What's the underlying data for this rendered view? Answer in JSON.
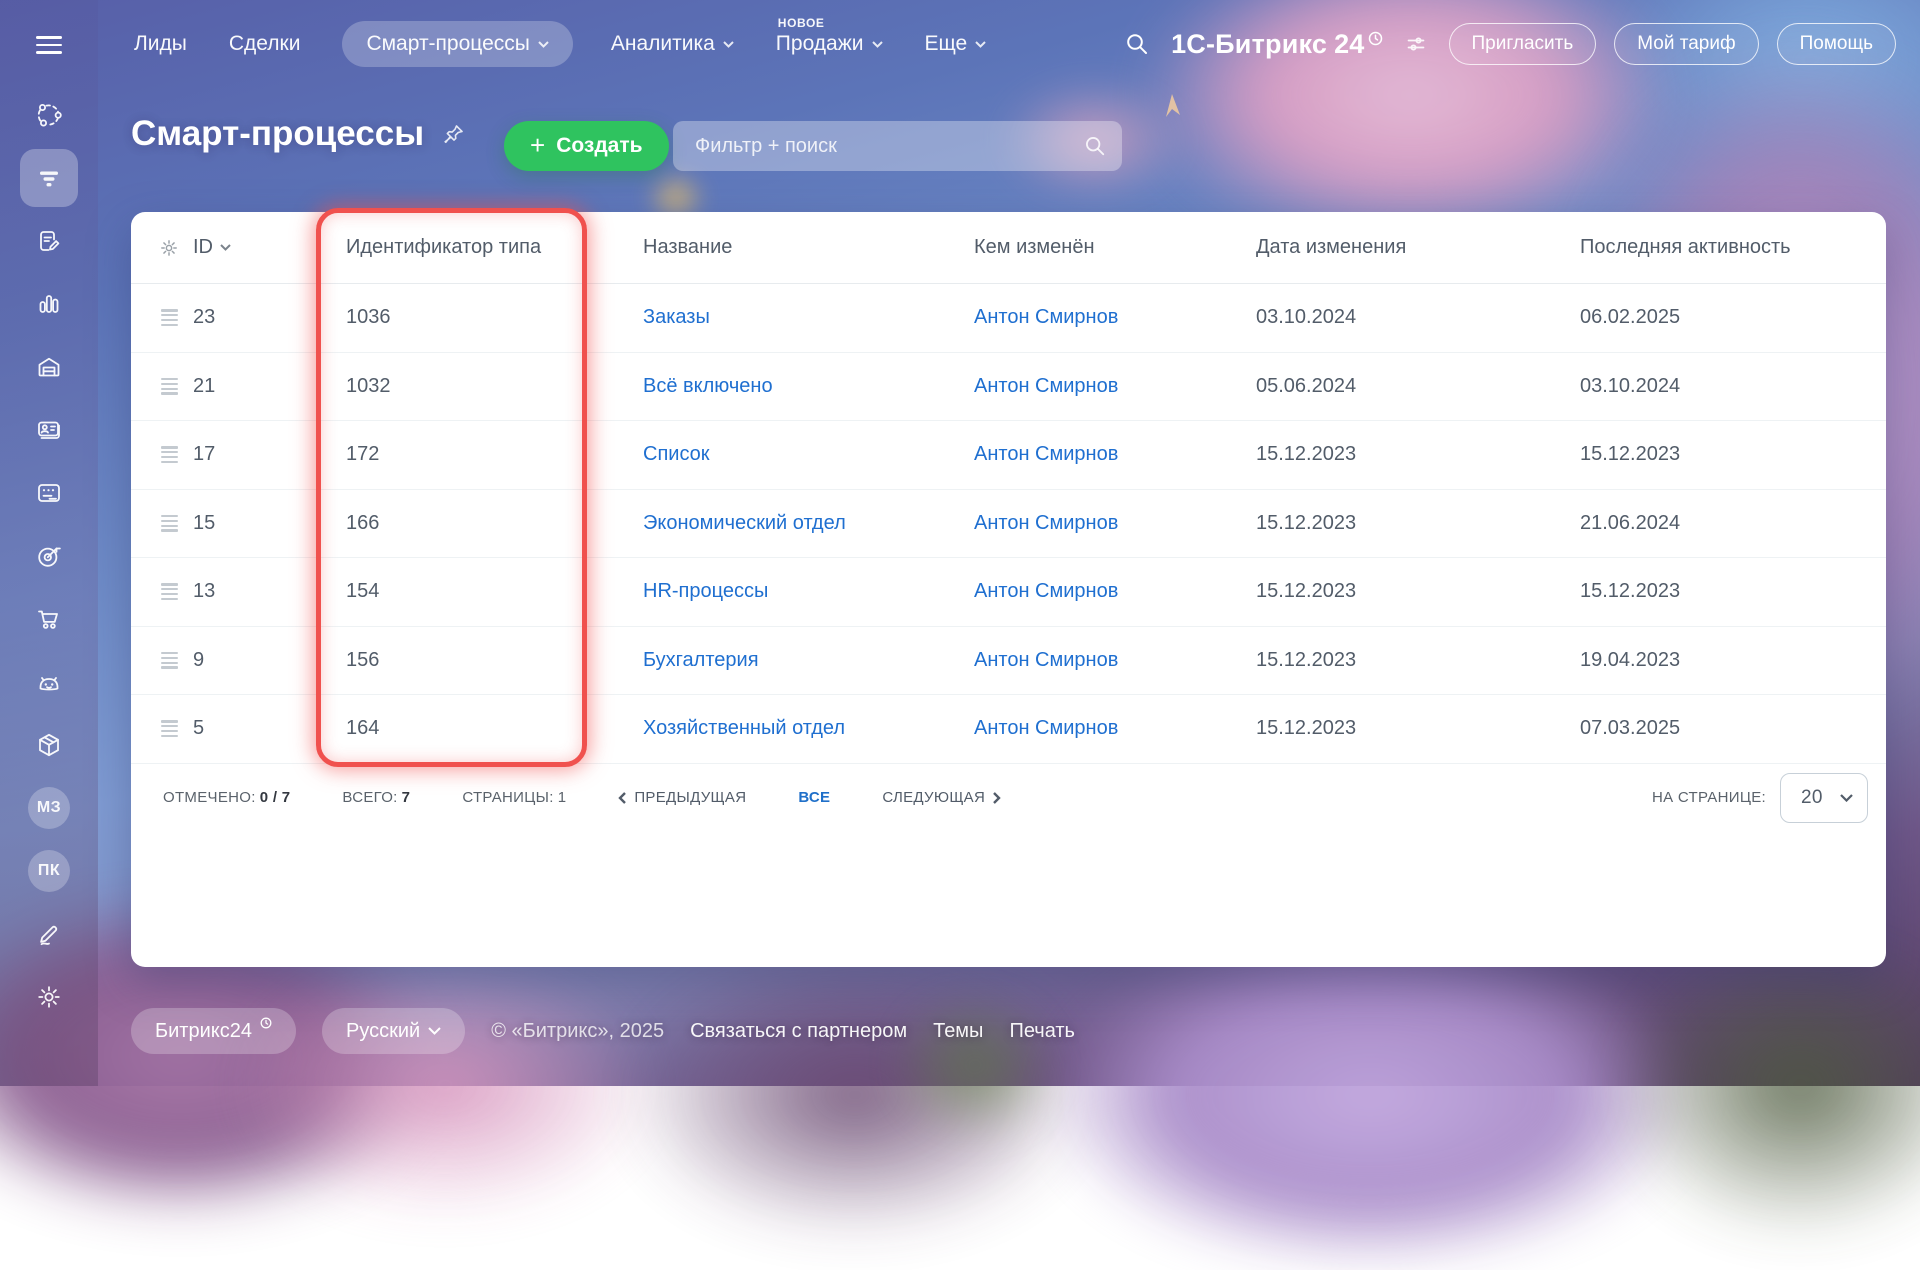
{
  "colors": {
    "accent_green": "#2fc35f",
    "link_blue": "#1f6fd0",
    "highlight_red": "#f0514e",
    "cell_text": "#525c69",
    "topbar_text": "#ffffff"
  },
  "topbar": {
    "nav": [
      {
        "label": "Лиды"
      },
      {
        "label": "Сделки"
      },
      {
        "label": "Смарт-процессы",
        "active": true
      },
      {
        "label": "Аналитика"
      },
      {
        "label": "Продажи",
        "badge": "НОВОЕ"
      },
      {
        "label": "Еще"
      }
    ],
    "logo_text": "1С-Битрикс",
    "logo_24": "24",
    "buttons": [
      "Пригласить",
      "Мой тариф",
      "Помощь"
    ]
  },
  "page": {
    "title": "Смарт-процессы",
    "create_label": "Создать",
    "create_plus": "+",
    "filter_placeholder": "Фильтр + поиск"
  },
  "table": {
    "columns": [
      "ID",
      "Идентификатор типа",
      "Название",
      "Кем изменён",
      "Дата изменения",
      "Последняя активность"
    ],
    "rows": [
      {
        "id": "23",
        "type_id": "1036",
        "name": "Заказы",
        "modified_by": "Антон Смирнов",
        "modified_date": "03.10.2024",
        "last_activity": "06.02.2025"
      },
      {
        "id": "21",
        "type_id": "1032",
        "name": "Всё включено",
        "modified_by": "Антон Смирнов",
        "modified_date": "05.06.2024",
        "last_activity": "03.10.2024"
      },
      {
        "id": "17",
        "type_id": "172",
        "name": "Список",
        "modified_by": "Антон Смирнов",
        "modified_date": "15.12.2023",
        "last_activity": "15.12.2023"
      },
      {
        "id": "15",
        "type_id": "166",
        "name": "Экономический отдел",
        "modified_by": "Антон Смирнов",
        "modified_date": "15.12.2023",
        "last_activity": "21.06.2024"
      },
      {
        "id": "13",
        "type_id": "154",
        "name": "HR-процессы",
        "modified_by": "Антон Смирнов",
        "modified_date": "15.12.2023",
        "last_activity": "15.12.2023"
      },
      {
        "id": "9",
        "type_id": "156",
        "name": "Бухгалтерия",
        "modified_by": "Антон Смирнов",
        "modified_date": "15.12.2023",
        "last_activity": "19.04.2023"
      },
      {
        "id": "5",
        "type_id": "164",
        "name": "Хозяйственный отдел",
        "modified_by": "Антон Смирнов",
        "modified_date": "15.12.2023",
        "last_activity": "07.03.2025"
      }
    ]
  },
  "pagination": {
    "checked_label": "ОТМЕЧЕНО:",
    "checked_value": "0 / 7",
    "total_label": "ВСЕГО:",
    "total_value": "7",
    "pages_label": "СТРАНИЦЫ:",
    "pages_value": "1",
    "prev_label": "ПРЕДЫДУЩАЯ",
    "all_label": "ВСЕ",
    "next_label": "СЛЕДУЮЩАЯ",
    "per_page_label": "НА СТРАНИЦЕ:",
    "per_page_value": "20"
  },
  "sidebar": {
    "icons": [
      "network-icon",
      "funnel-icon",
      "document-edit-icon",
      "bar-chart-icon",
      "warehouse-icon",
      "contact-card-icon",
      "calendar-icon",
      "target-icon",
      "cart-icon",
      "robot-icon",
      "package-icon",
      "badge-mz",
      "badge-pk",
      "signature-icon",
      "gear-icon"
    ],
    "active_icon": "funnel-icon",
    "badge_mz": "МЗ",
    "badge_pk": "ПК"
  },
  "footer": {
    "brand": "Битрикс24",
    "language": "Русский",
    "copyright": "© «Битрикс», 2025",
    "links": [
      "Связаться с партнером",
      "Темы",
      "Печать"
    ]
  }
}
